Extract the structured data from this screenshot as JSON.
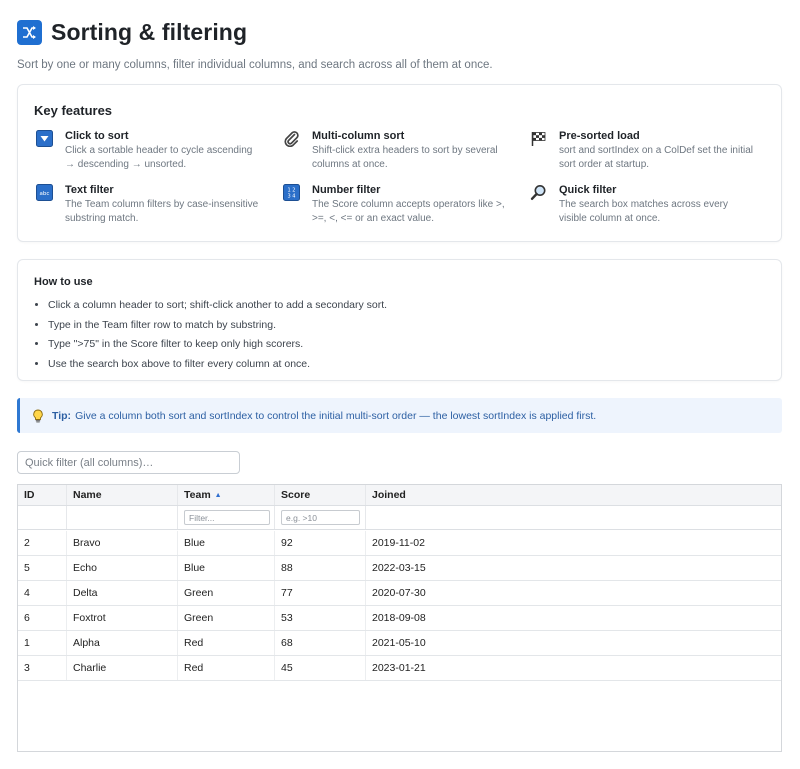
{
  "header": {
    "title": "Sorting & filtering",
    "subtitle": "Sort by one or many columns, filter individual columns, and search across all of them at once.",
    "title_icon": "shuffle-icon"
  },
  "features": {
    "title": "Key features",
    "items": [
      {
        "icon": "sort-down-icon",
        "title": "Click to sort",
        "desc": "Click a sortable header to cycle ascending → descending → unsorted."
      },
      {
        "icon": "paperclip-icon",
        "title": "Multi-column sort",
        "desc": "Shift-click extra headers to sort by several columns at once."
      },
      {
        "icon": "checkered-flag-icon",
        "title": "Pre-sorted load",
        "desc": "sort and sortIndex on a ColDef set the initial sort order at startup."
      },
      {
        "icon": "abc-input-icon",
        "title": "Text filter",
        "desc": "The Team column filters by case-insensitive substring match."
      },
      {
        "icon": "number-input-icon",
        "title": "Number filter",
        "desc": "The Score column accepts operators like >, >=, <, <= or an exact value."
      },
      {
        "icon": "magnifier-icon",
        "title": "Quick filter",
        "desc": "The search box matches across every visible column at once."
      }
    ]
  },
  "howto": {
    "title": "How to use",
    "items": [
      "Click a column header to sort; shift-click another to add a secondary sort.",
      "Type in the Team filter row to match by substring.",
      "Type \">75\" in the Score filter to keep only high scorers.",
      "Use the search box above to filter every column at once."
    ]
  },
  "tip": {
    "label": "Tip:",
    "text": "Give a column both sort and sortIndex to control the initial multi-sort order — the lowest sortIndex is applied first."
  },
  "quick_filter": {
    "placeholder": "Quick filter (all columns)…",
    "value": ""
  },
  "grid": {
    "columns": [
      "ID",
      "Name",
      "Team",
      "Score",
      "Joined"
    ],
    "sort_indicator": "▲",
    "sorted_column": "Team",
    "team_filter_placeholder": "Filter...",
    "score_filter_placeholder": "e.g. >10",
    "rows": [
      [
        "2",
        "Bravo",
        "Blue",
        "92",
        "2019-11-02"
      ],
      [
        "5",
        "Echo",
        "Blue",
        "88",
        "2022-03-15"
      ],
      [
        "4",
        "Delta",
        "Green",
        "77",
        "2020-07-30"
      ],
      [
        "6",
        "Foxtrot",
        "Green",
        "53",
        "2018-09-08"
      ],
      [
        "1",
        "Alpha",
        "Red",
        "68",
        "2021-05-10"
      ],
      [
        "3",
        "Charlie",
        "Red",
        "45",
        "2023-01-21"
      ]
    ]
  },
  "colors": {
    "accent": "#1f6fd1",
    "tip_background": "#eef4fd",
    "tip_border": "#2e78d2"
  }
}
